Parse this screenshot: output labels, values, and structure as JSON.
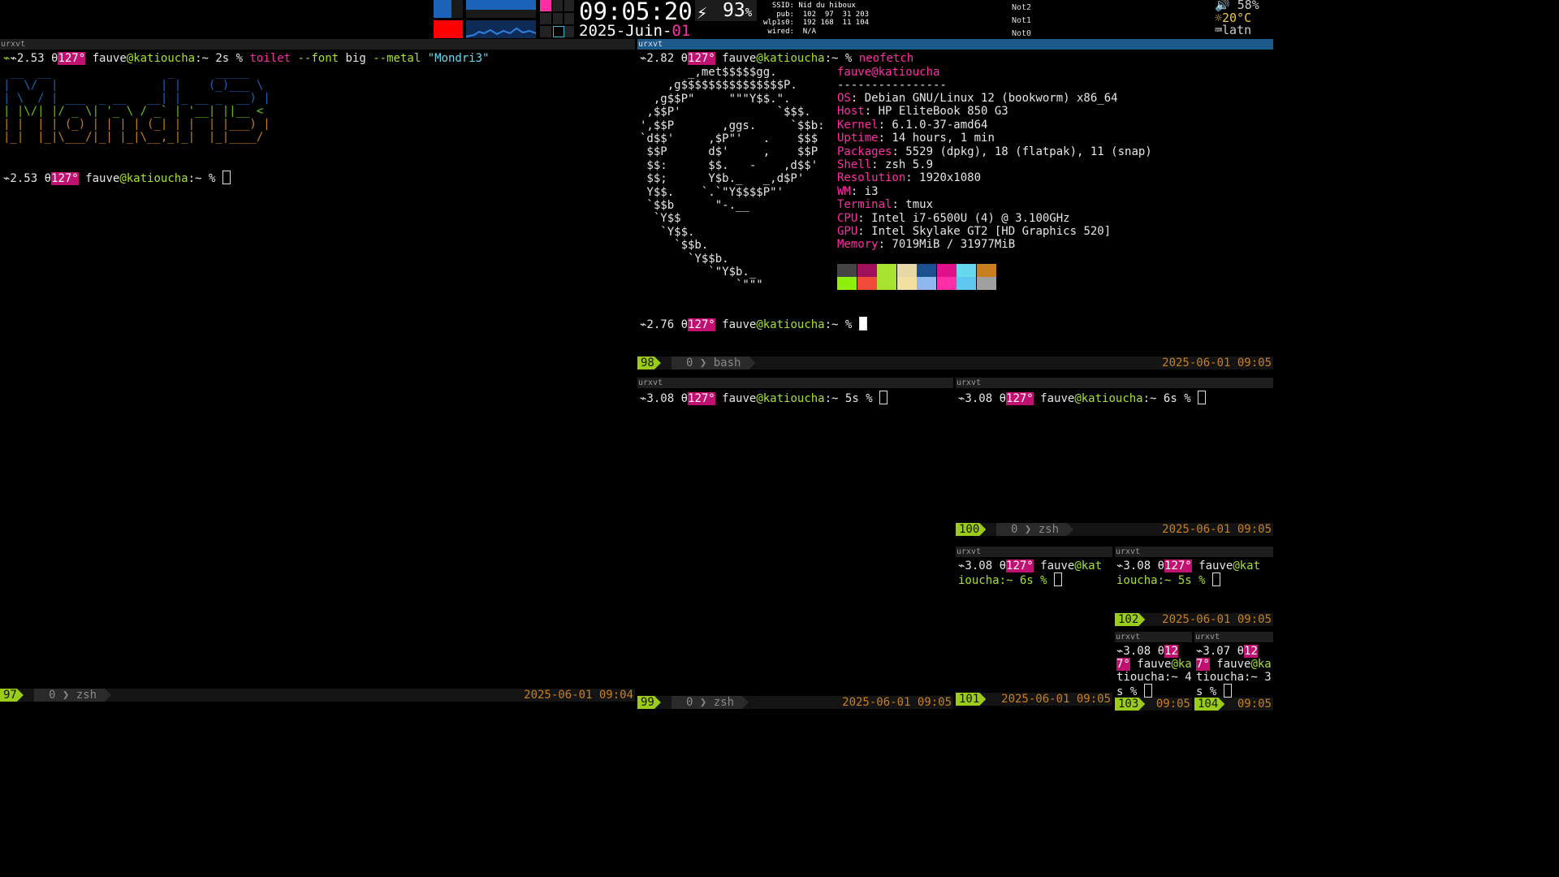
{
  "topbar": {
    "time": "09:05:20",
    "date_prefix": "2025-Juin-",
    "date_day": "01",
    "battery_value": "93",
    "battery_unit": "%",
    "network": "  SSID: Nid du hiboux\n   pub:  102  97  31 203\nwlp1s0:  192 168  11 104\n wired:  N/A",
    "notifications": [
      "Not2",
      "Not1",
      "Not0"
    ],
    "volume": "58%",
    "temperature": "20°C",
    "keyboard": "latn",
    "colors": {
      "cpu_block": "#1a63b8",
      "alert": "#ff0000",
      "accent": "#ff2ea6"
    }
  },
  "left": {
    "title": "urxvt",
    "prompt1_load": "⌁2.53 θ",
    "prompt_temp": "127°",
    "prompt_user": "fauve",
    "prompt_host": "@katioucha",
    "prompt1_dir": ":~ 2s % ",
    "cmd_name": "toilet",
    "cmd_flag1": " --font",
    "cmd_arg1": " big",
    "cmd_flag2": " --metal",
    "cmd_str": " \"Mondri3\"",
    "ascii": [
      " __  __                 _      _____ ",
      "|  \\/  |               | |    (_)___ \\",
      "| \\  / | ___  _ __   __| |_ __ _  __) |",
      "| |\\/| |/ _ \\| '_ \\ / _` | '__| ||__ <",
      "| |  | | (_) | | | | (_| | |  | |___) |",
      "|_|  |_|\\___/|_| |_|\\__,_|_|  |_|____/"
    ],
    "prompt2_load": "⌁2.53 θ",
    "prompt2_dir": ":~ % ",
    "status_num": "97",
    "status_win": "0 ❯ zsh",
    "status_date": "2025-06-01 09:04"
  },
  "neofetch": {
    "title": "urxvt",
    "prompt_load": "⌁2.82 θ",
    "prompt_temp": "127°",
    "prompt_user": "fauve",
    "prompt_host": "@katioucha",
    "prompt_dir": ":~ % ",
    "cmd": "neofetch",
    "logo": [
      "       _,met$$$$$gg.",
      "    ,g$$$$$$$$$$$$$$$P.",
      "  ,g$$P\"     \"\"\"Y$$.\".",
      " ,$$P'              `$$$.",
      "',$$P       ,ggs.     `$$b:",
      "`d$$'     ,$P\"'   .    $$$",
      " $$P      d$'     ,    $$P",
      " $$:      $$.   -    ,d$$'",
      " $$;      Y$b._   _,d$P'",
      " Y$$.    `.`\"Y$$$$P\"'",
      " `$$b      \"-.__",
      "  `Y$$",
      "   `Y$$.",
      "     `$$b.",
      "       `Y$$b.",
      "          `\"Y$b._",
      "              `\"\"\""
    ],
    "user": "fauve",
    "host": "@katioucha",
    "separator": "----------------",
    "info": [
      {
        "k": "OS",
        "v": ": Debian GNU/Linux 12 (bookworm) x86_64"
      },
      {
        "k": "Host",
        "v": ": HP EliteBook 850 G3"
      },
      {
        "k": "Kernel",
        "v": ": 6.1.0-37-amd64"
      },
      {
        "k": "Uptime",
        "v": ": 14 hours, 1 min"
      },
      {
        "k": "Packages",
        "v": ": 5529 (dpkg), 18 (flatpak), 11 (snap)"
      },
      {
        "k": "Shell",
        "v": ": zsh 5.9"
      },
      {
        "k": "Resolution",
        "v": ": 1920x1080"
      },
      {
        "k": "WM",
        "v": ": i3"
      },
      {
        "k": "Terminal",
        "v": ": tmux"
      },
      {
        "k": "CPU",
        "v": ": Intel i7-6500U (4) @ 3.100GHz"
      },
      {
        "k": "GPU",
        "v": ": Intel Skylake GT2 [HD Graphics 520]"
      },
      {
        "k": "Memory",
        "v": ": 7019MiB / 31977MiB"
      }
    ],
    "palette_top": [
      "#444444",
      "#a0105a",
      "#a6e22e",
      "#e8d8a8",
      "#1a4f90",
      "#e0108a",
      "#66d9ef",
      "#c8801e"
    ],
    "palette_bottom": [
      "#8ef00a",
      "#f04a3a",
      "#a6e22e",
      "#f2e0a0",
      "#8fb8f0",
      "#ff2ea6",
      "#5ec8f0",
      "#a0a0a0"
    ],
    "prompt2_load": "⌁2.76 θ",
    "prompt2_dir": ":~ % ",
    "status_num": "98",
    "status_win": "0 ❯ bash",
    "status_date": "2025-06-01 09:05"
  },
  "pane99": {
    "title": "urxvt",
    "load": "⌁3.08 θ",
    "temp": "127°",
    "user": "fauve",
    "host": "@katioucha",
    "dir": ":~ 5s % ",
    "num": "99",
    "win": "0 ❯ zsh",
    "date": "2025-06-01 09:05"
  },
  "pane100": {
    "title": "urxvt",
    "load": "⌁3.08 θ",
    "temp": "127°",
    "user": "fauve",
    "host": "@katioucha",
    "dir": ":~ 6s % ",
    "num": "100",
    "win": "0 ❯ zsh",
    "date": "2025-06-01 09:05"
  },
  "pane101": {
    "title": "urxvt",
    "l1a": "⌁3.08 θ",
    "l1temp": "127°",
    "l1user": " fauve",
    "l1host": "@kat",
    "l2": "ioucha:~ 6s % ",
    "num": "101",
    "date": "2025-06-01 09:05"
  },
  "pane102": {
    "title": "urxvt",
    "l1a": "⌁3.08 θ",
    "l1temp": "127°",
    "l1user": " fauve",
    "l1host": "@kat",
    "l2": "ioucha:~ 5s % ",
    "num": "102",
    "date": "2025-06-01 09:05"
  },
  "pane103": {
    "title": "urxvt",
    "l1a": "⌁3.08 θ",
    "l1temp": "12",
    "l2temp": "7°",
    "l2user": " fauve",
    "l2host": "@ka",
    "l3": "tioucha:~ 4",
    "l4": "s % ",
    "num": "103",
    "time": "09:05"
  },
  "pane104": {
    "title": "urxvt",
    "l1a": "⌁3.07 θ",
    "l1temp": "12",
    "l2temp": "7°",
    "l2user": " fauve",
    "l2host": "@ka",
    "l3": "tioucha:~ 3",
    "l4": "s % ",
    "num": "104",
    "time": "09:05"
  }
}
